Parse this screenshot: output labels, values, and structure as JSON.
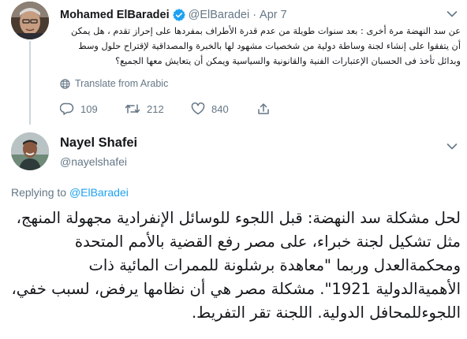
{
  "parent_tweet": {
    "author_name": "Mohamed ElBaradei",
    "handle": "@ElBaradei",
    "separator": "·",
    "date": "Apr 7",
    "verified": true,
    "text": "عن سد النهضة مرة أخرى : بعد سنوات طويلة من عدم قدرة الأطراف بمفردها على إحراز تقدم ، هل يمكن أن يتفقوا على إنشاء لجنة وساطة دولية من شخصيات مشهود لها بالخبرة والمصداقية لإقتراح حلول وسط وبدائل تأخذ فى الحسبان الإعتبارات الفنية والقانونية والسياسية ويمكن أن يتعايش معها الجميع؟",
    "translate_label": "Translate from Arabic",
    "replies": "109",
    "retweets": "212",
    "likes": "840"
  },
  "reply_tweet": {
    "author_name": "Nayel Shafei",
    "handle": "@nayelshafei",
    "replying_to_label": "Replying to",
    "replying_to_handle": "@ElBaradei",
    "text": "لحل مشكلة سد النهضة: قبل اللجوء للوسائل الإنفرادية مجهولة المنهج، مثل تشكيل لجنة خبراء، على مصر رفع القضية بالأمم المتحدة ومحكمةالعدل وربما \"معاهدة برشلونة للممرات المائية ذات الأهميةالدولية 1921\". مشكلة مصر هي أن نظامها يرفض، لسبب خفي، اللجوءللمحافل الدولية. اللجنة تقر التفريط."
  },
  "colors": {
    "text": "#14171a",
    "secondary": "#657786",
    "link": "#1da1f2",
    "thread_line": "#ccd6dd",
    "verified_badge": "#1da1f2"
  },
  "icons": [
    "verified-badge-icon",
    "chevron-down-icon",
    "translate-globe-icon",
    "reply-icon",
    "retweet-icon",
    "like-icon",
    "share-icon"
  ]
}
